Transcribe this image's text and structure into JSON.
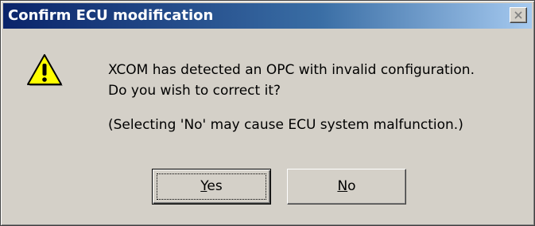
{
  "window": {
    "title": "Confirm ECU modification",
    "close_icon": "close-icon"
  },
  "message": {
    "icon": "warning-icon",
    "line1": "XCOM has detected an OPC with invalid configuration.",
    "line2": "Do you wish to correct it?",
    "line3": "(Selecting 'No' may cause ECU system malfunction.)"
  },
  "buttons": {
    "yes": {
      "mnemonic": "Y",
      "rest": "es",
      "label": "Yes"
    },
    "no": {
      "mnemonic": "N",
      "rest": "o",
      "label": "No"
    }
  },
  "colors": {
    "title_gradient_start": "#0a246a",
    "title_gradient_end": "#a6caf0",
    "dialog_face": "#d4d0c8",
    "warning_yellow": "#ffff00"
  }
}
